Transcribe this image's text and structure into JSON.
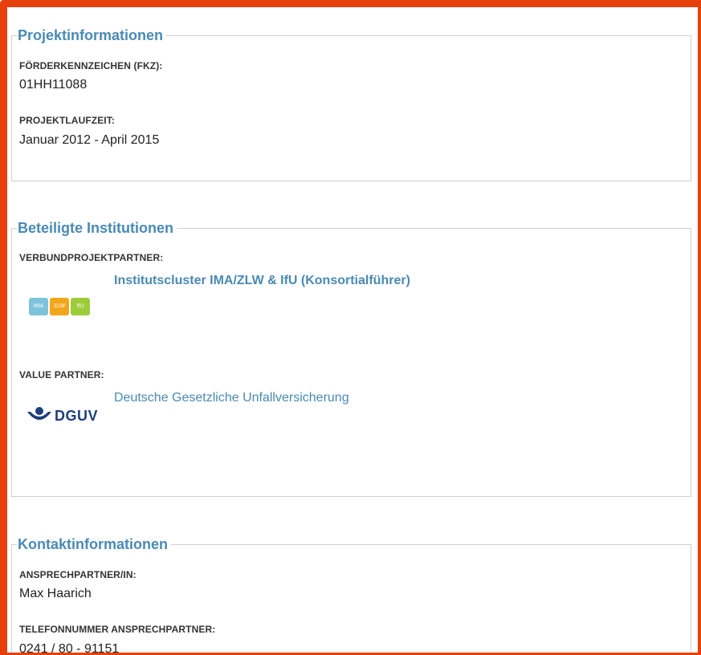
{
  "sections": {
    "projekt": {
      "title": "Projektinformationen",
      "fkz_label": "FÖRDERKENNZEICHEN (FKZ):",
      "fkz_value": "01HH11088",
      "laufzeit_label": "PROJEKTLAUFZEIT:",
      "laufzeit_value": "Januar 2012 - April 2015"
    },
    "institutionen": {
      "title": "Beteiligte Institutionen",
      "verbund_label": "VERBUNDPROJEKTPARTNER:",
      "verbund_partner": "Institutscluster IMA/ZLW & IfU (Konsortialführer)",
      "verbund_logo_parts": [
        "IMA",
        "ZLW",
        "IfU"
      ],
      "value_label": "VALUE PARTNER:",
      "value_partner": "Deutsche Gesetzliche Unfallversicherung",
      "value_logo_text": "DGUV"
    },
    "kontakt": {
      "title": "Kontaktinformationen",
      "ansprech_label": "ANSPRECHPARTNER/IN:",
      "ansprech_value": "Max Haarich",
      "telefon_label": "TELEFONNUMMER ANSPRECHPARTNER:",
      "telefon_value": "0241 / 80 - 91151"
    }
  },
  "colors": {
    "accent": "#4a8ab3",
    "frame": "#e8400c",
    "border": "#cfcfcf",
    "ima": "#7ec3dc",
    "zlw": "#f3a51c",
    "ifu": "#9ccc3a",
    "dguv": "#1d3f7a"
  }
}
